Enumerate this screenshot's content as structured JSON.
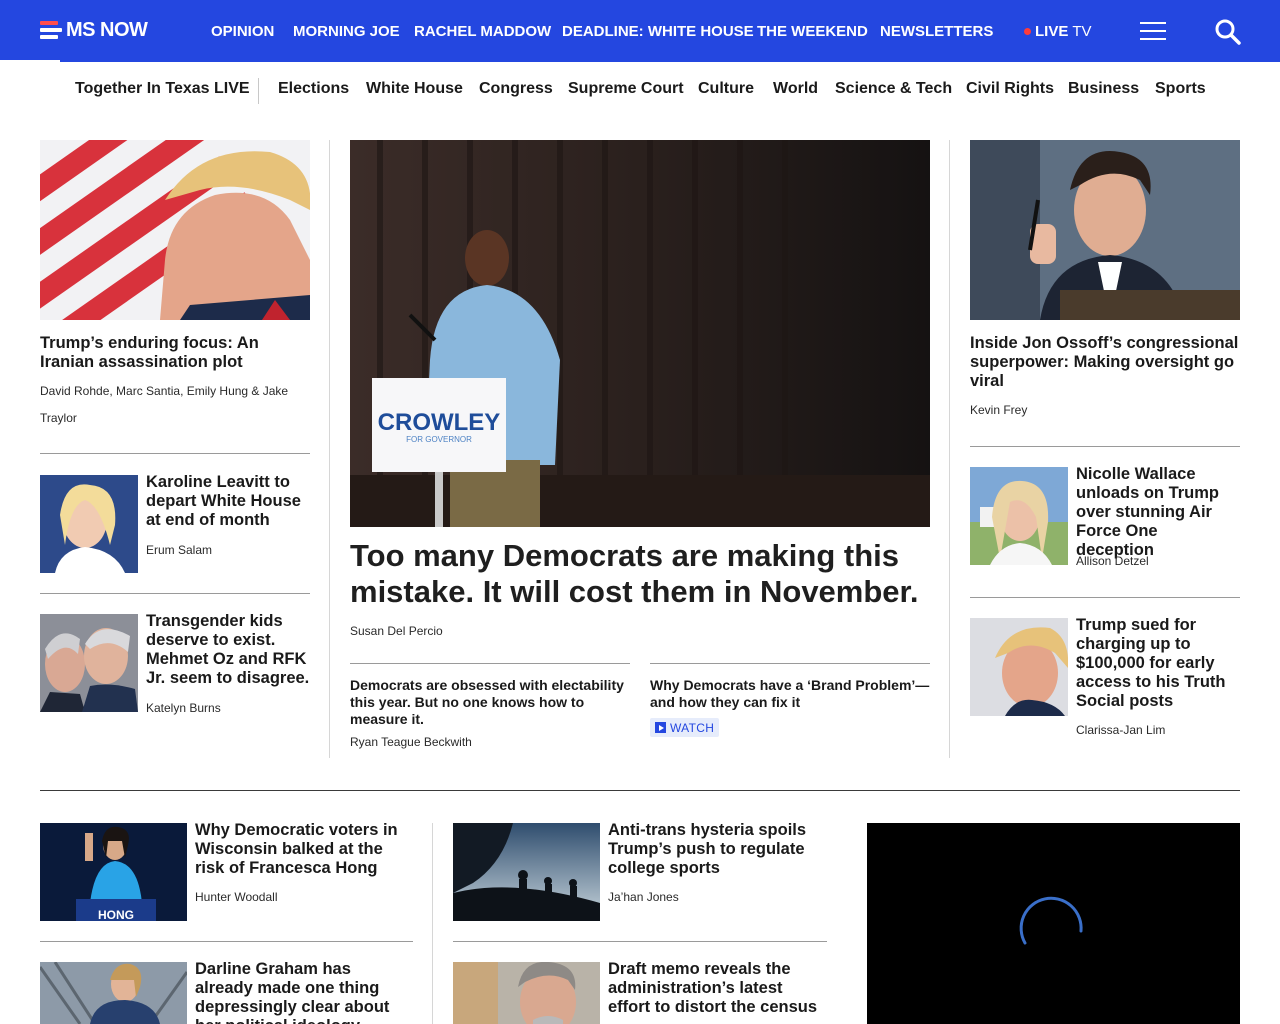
{
  "brand": {
    "name": "MS NOW"
  },
  "topnav": {
    "items": [
      "OPINION",
      "MORNING JOE",
      "RACHEL MADDOW",
      "DEADLINE: WHITE HOUSE",
      "THE WEEKEND",
      "NEWSLETTERS"
    ],
    "live_label": "LIVE",
    "live_suffix": "TV"
  },
  "subnav": {
    "featured": "Together In Texas LIVE",
    "items": [
      "Elections",
      "White House",
      "Congress",
      "Supreme Court",
      "Culture",
      "World",
      "Science & Tech",
      "Civil Rights",
      "Business",
      "Sports"
    ]
  },
  "left_column": {
    "lead": {
      "headline": "Trump’s enduring focus: An Iranian assassination plot",
      "byline_line1": "David Rohde, Marc Santia, Emily Hung & Jake",
      "byline_line2": "Traylor"
    },
    "stories": [
      {
        "headline": "Karoline Leavitt to depart White House at end of month",
        "byline": "Erum Salam"
      },
      {
        "headline": "Transgender kids deserve to exist. Mehmet Oz and RFK Jr. seem to disagree.",
        "byline": "Katelyn Burns"
      }
    ]
  },
  "center_column": {
    "image_sign_text": "CROWLEY",
    "image_sign_sub": "FOR GOVERNOR",
    "headline": "Too many Democrats are making this mistake. It will cost them in November.",
    "byline": "Susan Del Percio",
    "related": [
      {
        "headline": "Democrats are obsessed with electability this year. But no one knows how to measure it.",
        "byline": "Ryan Teague Beckwith"
      },
      {
        "headline": "Why Democrats have a ‘Brand Problem’— and how they can fix it",
        "badge": "WATCH"
      }
    ]
  },
  "right_column": {
    "lead": {
      "headline": "Inside Jon Ossoff’s congressional superpower: Making oversight go viral",
      "byline": "Kevin Frey"
    },
    "stories": [
      {
        "headline": "Nicolle Wallace unloads on Trump over stunning Air Force One deception",
        "byline": "Allison Detzel"
      },
      {
        "headline": "Trump sued for charging up to $100,000 for early access to his Truth Social posts",
        "byline": "Clarissa-Jan Lim"
      }
    ]
  },
  "lower_section": {
    "col1": [
      {
        "headline": "Why Democratic voters in Wisconsin balked at the risk of Francesca Hong",
        "byline": "Hunter Woodall",
        "image_sign_text": "HONG"
      },
      {
        "headline": "Darline Graham has already made one thing depressingly clear about her political ideology"
      }
    ],
    "col2": [
      {
        "headline": "Anti-trans hysteria spoils Trump’s push to regulate college sports",
        "byline": "Ja’han Jones"
      },
      {
        "headline": "Draft memo reveals the administration’s latest effort to distort the census"
      }
    ]
  },
  "colors": {
    "brand_blue": "#2447e0",
    "live_red": "#ff3b3b"
  }
}
